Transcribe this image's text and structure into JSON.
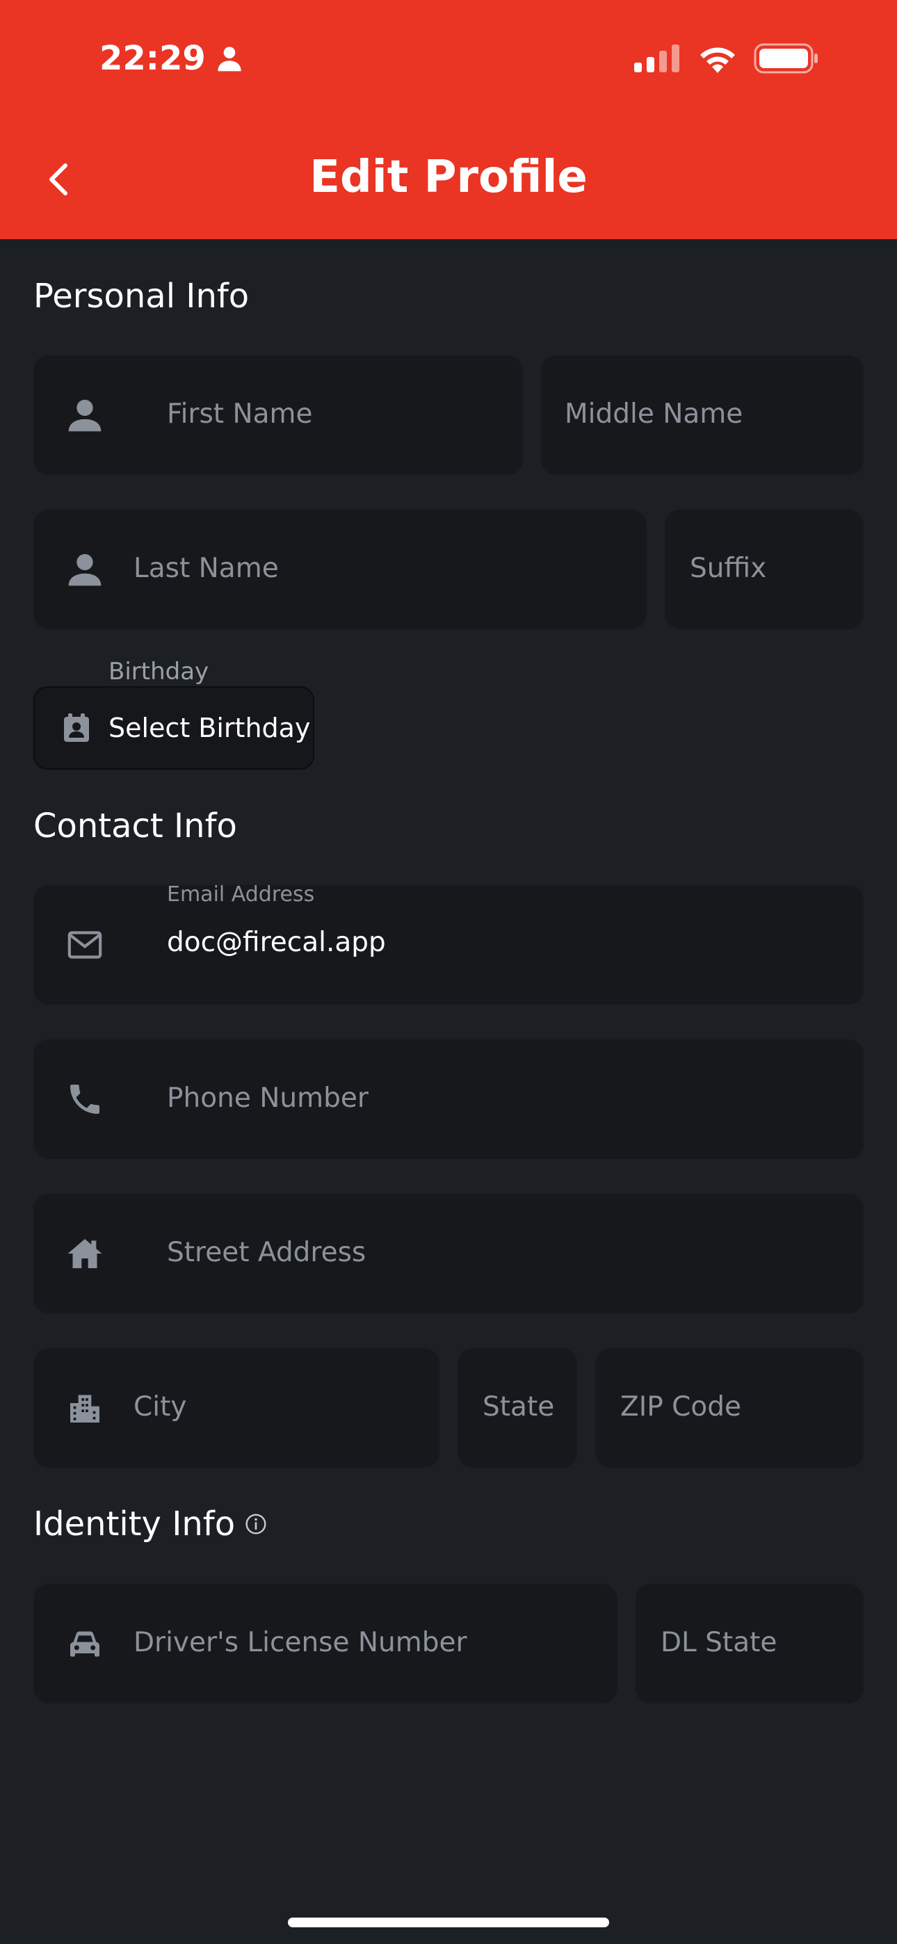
{
  "status_bar": {
    "time": "22:29"
  },
  "header": {
    "title": "Edit Profile"
  },
  "sections": {
    "personal": "Personal Info",
    "contact": "Contact Info",
    "identity": "Identity Info"
  },
  "fields": {
    "first_name": "First Name",
    "middle_name": "Middle Name",
    "last_name": "Last Name",
    "suffix": "Suffix",
    "birthday_label": "Birthday",
    "birthday_button": "Select Birthday",
    "email_label": "Email Address",
    "email_value": "doc@firecal.app",
    "phone": "Phone Number",
    "street": "Street Address",
    "city": "City",
    "state": "State",
    "zip": "ZIP Code",
    "dl_number": "Driver's License Number",
    "dl_state": "DL State"
  },
  "colors": {
    "header_bg": "#ea3424",
    "page_bg": "#1c1f24",
    "field_bg": "#16181c",
    "placeholder": "#8b929b"
  }
}
